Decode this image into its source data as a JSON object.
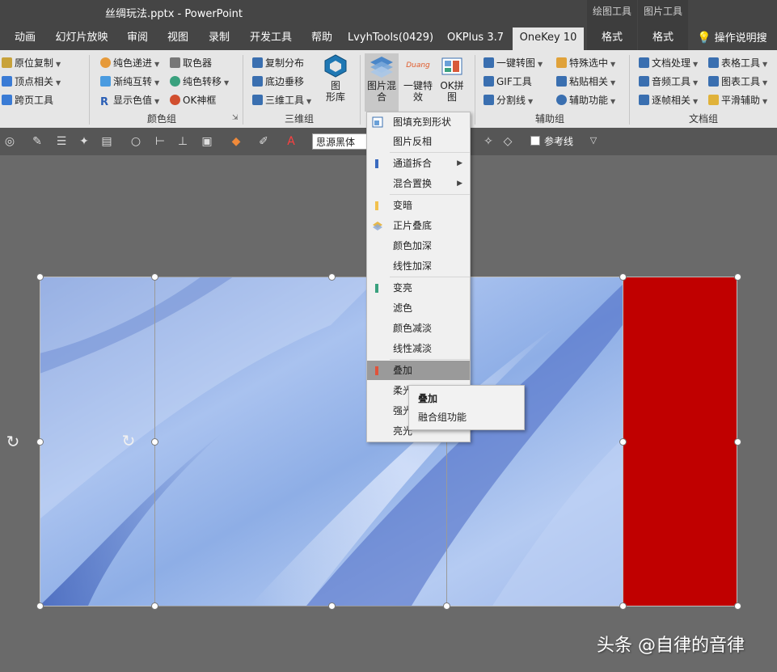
{
  "window": {
    "title": "丝绸玩法.pptx  -  PowerPoint"
  },
  "context_tabs": {
    "drawing_tools": "绘图工具",
    "picture_tools": "图片工具"
  },
  "tabs": [
    "动画",
    "幻灯片放映",
    "审阅",
    "视图",
    "录制",
    "开发工具",
    "帮助",
    "LvyhTools(0429)",
    "OKPlus 3.7",
    "OneKey 10",
    "格式",
    "格式",
    "操作说明搜索"
  ],
  "active_tab_index": 9,
  "ribbon": {
    "g1": [
      "原位复制",
      "顶点相关",
      "跨页工具"
    ],
    "g2": [
      "纯色递进",
      "渐纯互转",
      "显示色值",
      "取色器",
      "纯色转移",
      "OK神框"
    ],
    "g2_label": "颜色组",
    "g3": [
      "复制分布",
      "底边垂移",
      "三维工具"
    ],
    "g3_big": "图\n形库",
    "g3_label": "三维组",
    "big_buttons": [
      "图片混\n合",
      "一键特\n效",
      "OK拼\n图"
    ],
    "duang_text": "Duang",
    "g5": [
      "一键转图",
      "GIF工具",
      "分割线",
      "特殊选中",
      "粘贴相关",
      "辅助功能"
    ],
    "g5_label": "辅助组",
    "g6": [
      "文档处理",
      "音频工具",
      "逐帧相关",
      "表格工具",
      "图表工具",
      "平滑辅助"
    ],
    "g6_label": "文档组"
  },
  "format_bar": {
    "font": "思源黑体",
    "ref_line": "参考线"
  },
  "menu": {
    "items": [
      {
        "label": "图填充到形状",
        "icon": "fill-shape",
        "mark": ""
      },
      {
        "label": "图片反相",
        "icon": "",
        "mark": ""
      },
      {
        "label": "通道拆合",
        "icon": "",
        "mark": "#3b6bbf",
        "sub": true
      },
      {
        "label": "混合置换",
        "icon": "",
        "mark": "",
        "sub": true
      },
      {
        "label": "变暗",
        "icon": "",
        "mark": "#f2c14e"
      },
      {
        "label": "正片叠底",
        "icon": "layers",
        "mark": ""
      },
      {
        "label": "颜色加深",
        "icon": "",
        "mark": ""
      },
      {
        "label": "线性加深",
        "icon": "",
        "mark": ""
      },
      {
        "label": "变亮",
        "icon": "",
        "mark": "#3aa17e"
      },
      {
        "label": "滤色",
        "icon": "",
        "mark": ""
      },
      {
        "label": "颜色减淡",
        "icon": "",
        "mark": ""
      },
      {
        "label": "线性减淡",
        "icon": "",
        "mark": ""
      },
      {
        "label": "叠加",
        "icon": "",
        "mark": "#e0533b",
        "highlight": true
      },
      {
        "label": "柔光",
        "icon": "",
        "mark": ""
      },
      {
        "label": "强光",
        "icon": "",
        "mark": ""
      },
      {
        "label": "亮光",
        "icon": "",
        "mark": ""
      }
    ],
    "submenu_arrow": "▶"
  },
  "tooltip": {
    "title": "叠加",
    "desc": "融合组功能"
  },
  "watermark": "头条 @自律的音律",
  "colors": {
    "accent_tab": "#e6e6e6",
    "red_rect": "#c00000",
    "highlight": "#9a9a9a"
  }
}
